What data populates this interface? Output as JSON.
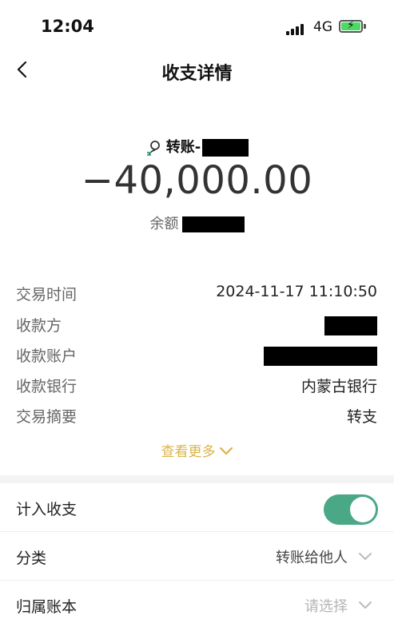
{
  "status_bar": {
    "time": "12:04",
    "network": "4G"
  },
  "header": {
    "title": "收支详情"
  },
  "summary": {
    "payee_label": "转账-",
    "amount": "−40,000.00",
    "balance_label": "余额"
  },
  "details": [
    {
      "label": "交易时间",
      "value": "2024-11-17 11:10:50"
    },
    {
      "label": "收款方",
      "value": ""
    },
    {
      "label": "收款账户",
      "value": ""
    },
    {
      "label": "收款银行",
      "value": "内蒙古银行"
    },
    {
      "label": "交易摘要",
      "value": "转支"
    }
  ],
  "show_more": "查看更多",
  "settings": {
    "include_label": "计入收支",
    "include_enabled": true,
    "category_label": "分类",
    "category_value": "转账给他人",
    "account_label": "归属账本",
    "account_placeholder": "请选择"
  },
  "colors": {
    "toggle_on": "#4aa886",
    "link": "#d9b44a"
  }
}
